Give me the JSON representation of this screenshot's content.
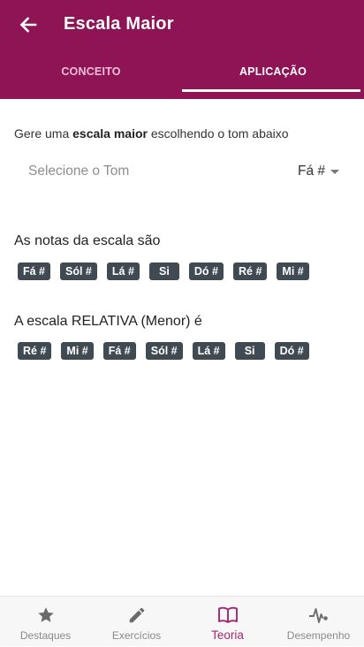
{
  "app": {
    "title": "Escala Maior",
    "accent_color": "#8e1456",
    "tabs": [
      {
        "label": "CONCEITO",
        "active": false
      },
      {
        "label": "APLICAÇÃO",
        "active": true
      }
    ]
  },
  "main": {
    "intro_prefix": "Gere uma ",
    "intro_bold": "escala maior",
    "intro_suffix": " escolhendo o tom abaixo",
    "select": {
      "placeholder": "Selecione o Tom",
      "value": "Fá #"
    },
    "scale_label": "As notas da escala são",
    "scale_notes": [
      "Fá #",
      "Sól #",
      "Lá #",
      "Si",
      "Dó #",
      "Ré #",
      "Mi #"
    ],
    "relative_label": "A escala RELATIVA (Menor) é",
    "relative_notes": [
      "Ré #",
      "Mi #",
      "Fá #",
      "Sól #",
      "Lá #",
      "Si",
      "Dó #"
    ]
  },
  "bottom_nav": {
    "items": [
      {
        "label": "Destaques",
        "icon": "star-icon",
        "active": false
      },
      {
        "label": "Exercícios",
        "icon": "pencil-icon",
        "active": false
      },
      {
        "label": "Teoria",
        "icon": "book-icon",
        "active": true
      },
      {
        "label": "Desempenho",
        "icon": "pulse-icon",
        "active": false
      }
    ]
  }
}
